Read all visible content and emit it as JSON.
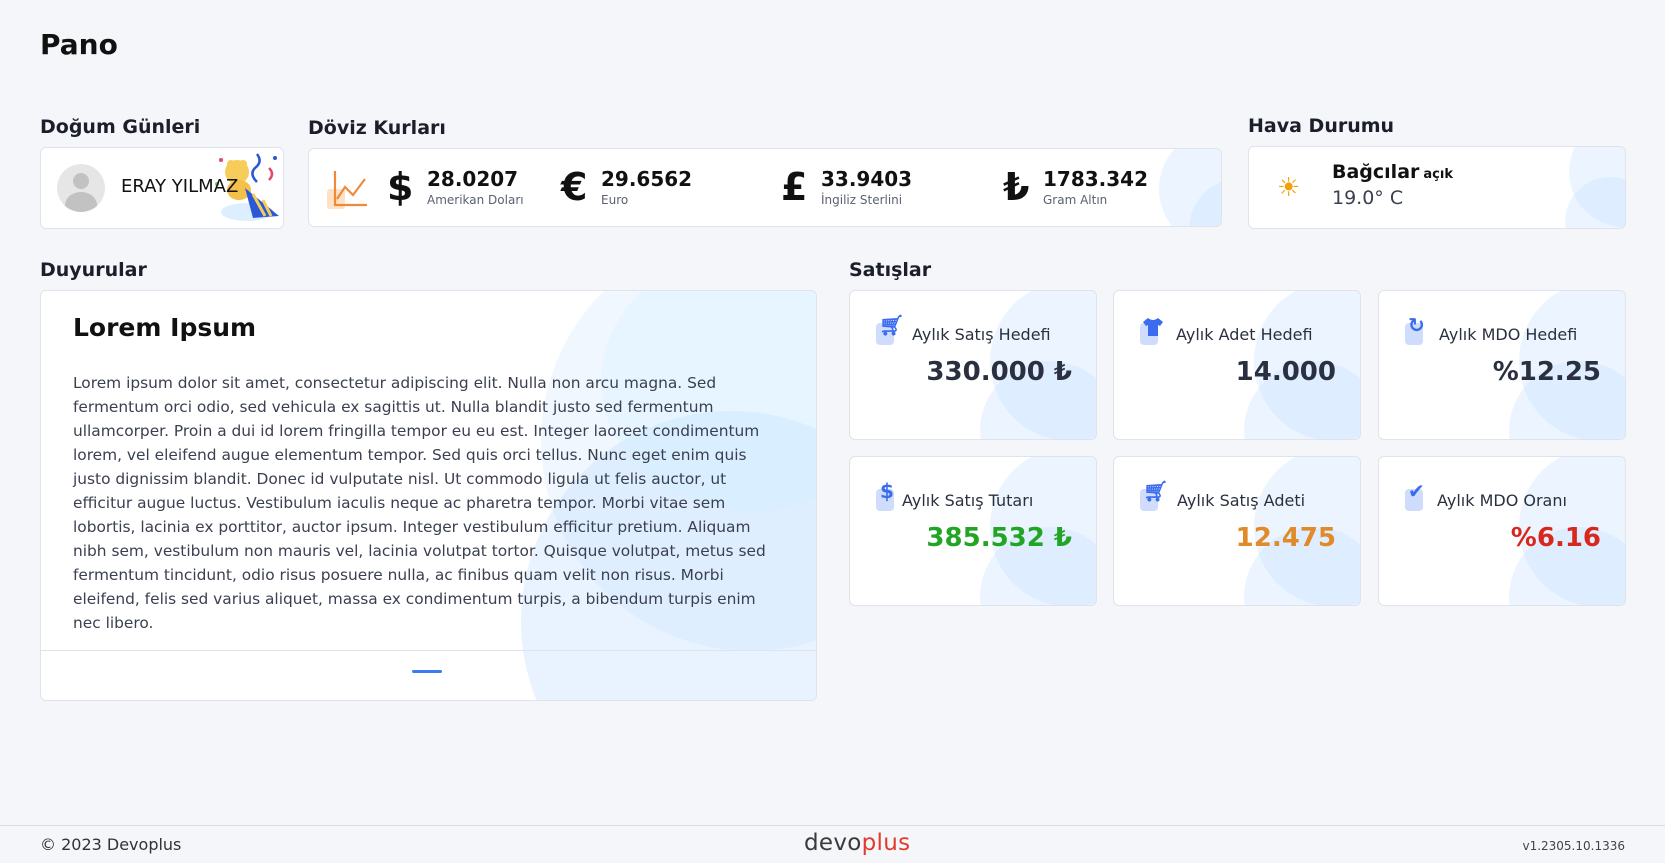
{
  "page": {
    "title": "Pano"
  },
  "birthdays": {
    "title": "Doğum Günleri",
    "name": "ERAY YILMAZ"
  },
  "currency": {
    "title": "Döviz Kurları",
    "items": [
      {
        "symbol": "$",
        "value": "28.0207",
        "name": "Amerikan Doları"
      },
      {
        "symbol": "€",
        "value": "29.6562",
        "name": "Euro"
      },
      {
        "symbol": "£",
        "value": "33.9403",
        "name": "İngiliz Sterlini"
      },
      {
        "symbol": "₺",
        "value": "1783.342",
        "name": "Gram Altın"
      }
    ]
  },
  "weather": {
    "title": "Hava Durumu",
    "city": "Bağcılar",
    "condition": "açık",
    "temperature": "19.0° C"
  },
  "announcements": {
    "title": "Duyurular",
    "card_title": "Lorem Ipsum",
    "body": "Lorem ipsum dolor sit amet, consectetur adipiscing elit. Nulla non arcu magna. Sed fermentum orci odio, sed vehicula ex sagittis ut. Nulla blandit justo sed fermentum ullamcorper. Proin a dui id lorem fringilla tempor eu eu est. Integer laoreet condimentum lorem, vel eleifend augue elementum tempor. Sed quis orci tellus. Nunc eget enim quis justo dignissim blandit. Donec id vulputate nisl. Ut commodo ligula ut felis auctor, ut efficitur augue luctus. Vestibulum iaculis neque ac pharetra tempor. Morbi vitae sem lobortis, lacinia ex porttitor, auctor ipsum. Integer vestibulum efficitur pretium. Aliquam nibh sem, vestibulum non mauris vel, lacinia volutpat tortor. Quisque volutpat, metus sed fermentum tincidunt, odio risus posuere nulla, ac finibus quam velit non risus. Morbi eleifend, felis sed varius aliquet, massa ex condimentum turpis, a bibendum turpis enim nec libero."
  },
  "sales": {
    "title": "Satışlar",
    "cards": [
      {
        "label": "Aylık Satış Hedefi",
        "value": "330.000 ₺",
        "icon": "cart-icon",
        "color": "#2a3040"
      },
      {
        "label": "Aylık Adet Hedefi",
        "value": "14.000",
        "icon": "shirt-icon",
        "color": "#2a3040"
      },
      {
        "label": "Aylık MDO Hedefi",
        "value": "%12.25",
        "icon": "refresh-icon",
        "color": "#2a3040"
      },
      {
        "label": "Aylık Satış Tutarı",
        "value": "385.532 ₺",
        "icon": "dollar-icon",
        "color": "#22a524"
      },
      {
        "label": "Aylık Satış Adeti",
        "value": "12.475",
        "icon": "cart-icon",
        "color": "#e08a2a"
      },
      {
        "label": "Aylık MDO Oranı",
        "value": "%6.16",
        "icon": "check-icon",
        "color": "#d8281e"
      }
    ]
  },
  "footer": {
    "copyright": "© 2023 Devoplus",
    "brand_part1": "devo",
    "brand_part2": "plus",
    "version": "v1.2305.10.1336"
  }
}
